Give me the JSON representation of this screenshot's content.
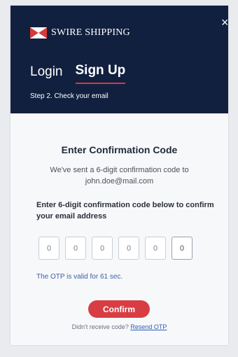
{
  "brand": {
    "name": "SWIRE SHIPPING"
  },
  "header": {
    "close_symbol": "×",
    "tabs": [
      {
        "label": "Login",
        "active": false
      },
      {
        "label": "Sign Up",
        "active": true
      }
    ],
    "step_text": "Step 2. Check your email"
  },
  "content": {
    "title": "Enter Confirmation Code",
    "sent_line1": "We've sent a 6-digit confirmation code to",
    "sent_line2": "john.doe@mail.com",
    "instruction": "Enter 6-digit confirmation code below to confirm your email address",
    "otp_digits": [
      "0",
      "0",
      "0",
      "0",
      "0",
      "0"
    ],
    "otp_valid_text": "The OTP is valid for 61 sec.",
    "confirm_label": "Confirm",
    "resend_prefix": "Didn't receive code?",
    "resend_link": "Resend OTP"
  },
  "colors": {
    "header_bg": "#11203f",
    "accent": "#d83d44",
    "link": "#2c5db6"
  },
  "icons": {
    "close": "close-icon",
    "flag": "flag-logo-icon"
  }
}
